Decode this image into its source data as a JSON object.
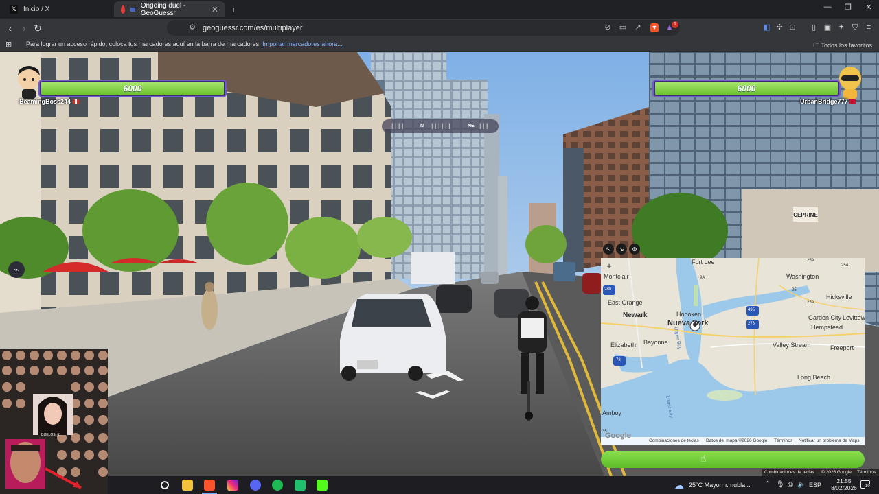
{
  "browser": {
    "tabs": [
      {
        "title": "Inicio / X",
        "icon": "x-logo-icon"
      },
      {
        "title": "Ongoing duel - GeoGuessr",
        "icon": "geoguessr-icon"
      }
    ],
    "new_tab": "+",
    "url": "geoguessr.com/es/multiplayer",
    "bookmarks_text": "Para lograr un acceso rápido, coloca tus marcadores aquí en la barra de marcadores.",
    "bookmarks_link": "Importar marcadores ahora...",
    "bookmarks_folder": "Todos los favoritos",
    "extension_badge": "1"
  },
  "game": {
    "player_left": {
      "name": "BeamingBoss244",
      "health": "6000"
    },
    "player_right": {
      "name": "UrbanBridge777",
      "health": "6000"
    },
    "compass": {
      "north": "N",
      "northeast": "NE"
    },
    "sign_text": "CEPRINE"
  },
  "map": {
    "zoom_in": "+",
    "labels": [
      {
        "text": "Fort Lee",
        "cls": ""
      },
      {
        "text": "Washington",
        "cls": ""
      },
      {
        "text": "Montclair",
        "cls": ""
      },
      {
        "text": "East Orange",
        "cls": ""
      },
      {
        "text": "Newark",
        "cls": "big"
      },
      {
        "text": "Hoboken",
        "cls": ""
      },
      {
        "text": "Nueva York",
        "cls": "big"
      },
      {
        "text": "Hicksville",
        "cls": ""
      },
      {
        "text": "Garden City",
        "cls": ""
      },
      {
        "text": "Hempstead",
        "cls": ""
      },
      {
        "text": "Levittown",
        "cls": ""
      },
      {
        "text": "Elizabeth",
        "cls": ""
      },
      {
        "text": "Bayonne",
        "cls": ""
      },
      {
        "text": "Valley Stream",
        "cls": ""
      },
      {
        "text": "Freeport",
        "cls": ""
      },
      {
        "text": "Long Beach",
        "cls": ""
      },
      {
        "text": "Amboy",
        "cls": ""
      },
      {
        "text": "Upper Bay",
        "cls": ""
      },
      {
        "text": "Lower Bay",
        "cls": ""
      }
    ],
    "footer": {
      "logo": "Google",
      "shortcuts": "Combinaciones de teclas",
      "data": "Datos del mapa ©2026 Google",
      "terms": "Términos",
      "report": "Notificar un problema de Maps"
    },
    "route_numbers": [
      "25A",
      "25A",
      "25",
      "9A",
      "25A",
      "280",
      "495",
      "278",
      "78",
      "35"
    ]
  },
  "page_footer": {
    "shortcuts": "Combinaciones de teclas",
    "copyright": "© 2026 Google",
    "terms": "Términos"
  },
  "taskbar": {
    "weather": "25°C  Mayorm. nubla...",
    "language": "ESP",
    "time": "21:55",
    "date": "8/02/2026",
    "notifications": "10"
  },
  "webcam": {
    "caption": "DUELOS: 61"
  }
}
